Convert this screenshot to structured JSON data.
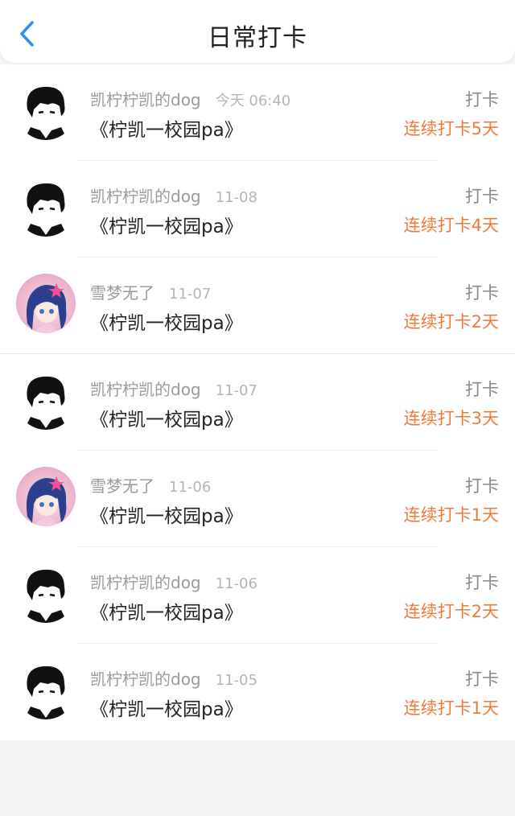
{
  "header": {
    "title": "日常打卡",
    "back_icon": "chevron-left-icon"
  },
  "colors": {
    "accent": "#2b8ff7",
    "streak": "#f07a3c"
  },
  "checkins": [
    {
      "username": "凯柠柠凯的dog",
      "time": "今天 06:40",
      "group": "《柠凯一校园pa》",
      "action": "打卡",
      "streak": "连续打卡5天",
      "avatar": "boy-avatar"
    },
    {
      "username": "凯柠柠凯的dog",
      "time": "11-08",
      "group": "《柠凯一校园pa》",
      "action": "打卡",
      "streak": "连续打卡4天",
      "avatar": "boy-avatar"
    },
    {
      "username": "雪梦无了",
      "time": "11-07",
      "group": "《柠凯一校园pa》",
      "action": "打卡",
      "streak": "连续打卡2天",
      "avatar": "girl-avatar"
    },
    {
      "username": "凯柠柠凯的dog",
      "time": "11-07",
      "group": "《柠凯一校园pa》",
      "action": "打卡",
      "streak": "连续打卡3天",
      "avatar": "boy-avatar"
    },
    {
      "username": "雪梦无了",
      "time": "11-06",
      "group": "《柠凯一校园pa》",
      "action": "打卡",
      "streak": "连续打卡1天",
      "avatar": "girl-avatar"
    },
    {
      "username": "凯柠柠凯的dog",
      "time": "11-06",
      "group": "《柠凯一校园pa》",
      "action": "打卡",
      "streak": "连续打卡2天",
      "avatar": "boy-avatar"
    },
    {
      "username": "凯柠柠凯的dog",
      "time": "11-05",
      "group": "《柠凯一校园pa》",
      "action": "打卡",
      "streak": "连续打卡1天",
      "avatar": "boy-avatar"
    }
  ]
}
